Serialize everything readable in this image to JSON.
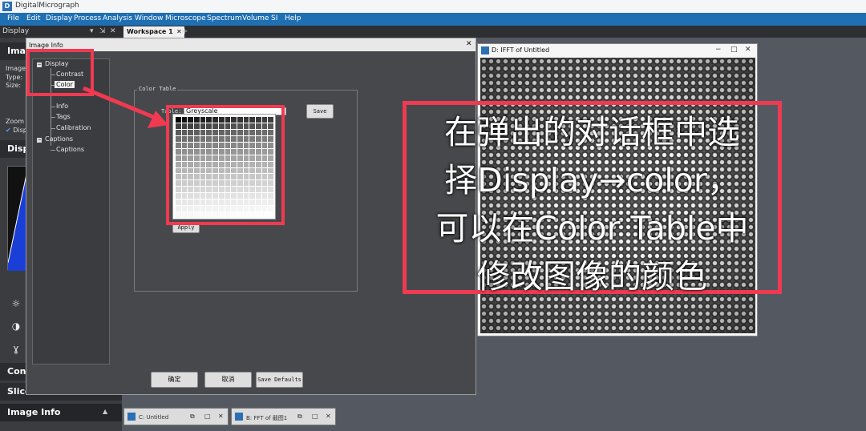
{
  "app": {
    "title": "DigitalMicrograph",
    "icon": "dm-app-icon"
  },
  "menu": [
    "File",
    "Edit",
    "Display",
    "Process",
    "Analysis",
    "Window",
    "Microscope",
    "Spectrum",
    "Volume",
    "SI",
    "Help"
  ],
  "left_panel": {
    "header": "Display",
    "controls": [
      "▾",
      "⇲",
      "✕"
    ],
    "image_section_title": "Imag",
    "image_lines": [
      "Image",
      "Type:",
      "Size:"
    ],
    "zoom_label": "Zoom",
    "disp_check": "Disp",
    "display_section_title": "Disp",
    "tools": [
      "sun-icon",
      "contrast-icon",
      "gamma-icon"
    ],
    "sections": [
      "Cont",
      "Slice",
      "Image Info"
    ],
    "collapse_glyph": "▲"
  },
  "workspace": {
    "tab_label": "Workspace 1",
    "tab_close": "✕",
    "add_tab": "+"
  },
  "fft_window": {
    "title": "D: IFFT of Untitled",
    "buttons": [
      "−",
      "□",
      "✕"
    ]
  },
  "dialog": {
    "title": "Image Info",
    "close": "✕",
    "tree": {
      "display": "Display",
      "contrast": "Contrast",
      "color": "Color",
      "info": "Info",
      "tags": "Tags",
      "calibration": "Calibration",
      "captions_group": "Captions",
      "captions": "Captions",
      "expand_glyph": "−"
    },
    "color_table_legend": "Color Table",
    "table_label": "Table:",
    "table_value": "Greyscale",
    "save_label": "Save",
    "apply_label": "Apply",
    "ok_label": "确定",
    "cancel_label": "取消",
    "save_defaults_label": "Save Defaults",
    "grid_colors": {
      "start": "#000000",
      "end": "#ffffff"
    }
  },
  "minimized_windows": [
    {
      "title": "C: Untitled",
      "buttons": [
        "⧉",
        "□",
        "✕"
      ]
    },
    {
      "title": "B: FFT of 截图1",
      "buttons": [
        "⧉",
        "□",
        "✕"
      ]
    }
  ],
  "annotation": {
    "lines": [
      "在弹出的对话框中选",
      "择Display→color，",
      "可以在Color Table中",
      "修改图像的颜色"
    ],
    "color": "#ef3a52"
  }
}
